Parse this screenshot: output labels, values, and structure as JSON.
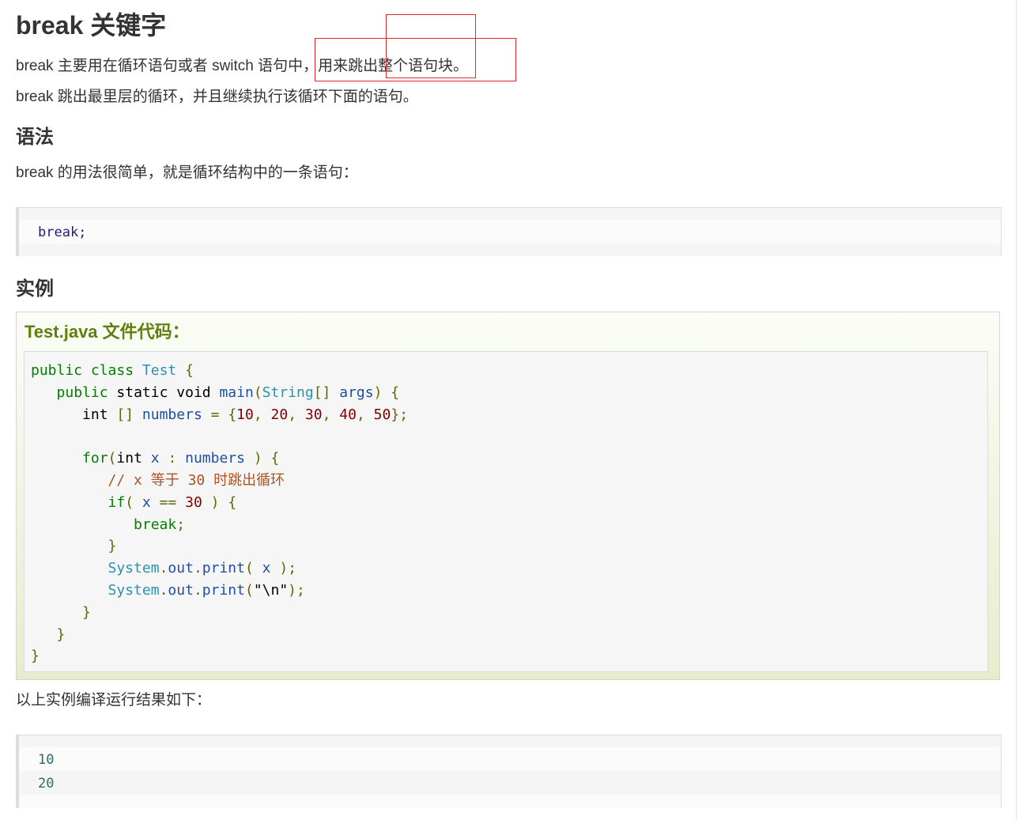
{
  "title": "break 关键字",
  "intro": {
    "line1": "break 主要用在循环语句或者 switch 语句中，用来跳出整个语句块。",
    "line2": "break 跳出最里层的循环，并且继续执行该循环下面的语句。"
  },
  "syntax": {
    "heading": "语法",
    "desc": "break 的用法很简单，就是循环结构中的一条语句：",
    "code": "break;"
  },
  "example": {
    "heading": "实例",
    "file_title": "Test.java 文件代码：",
    "code_lines": [
      "public class Test {",
      "   public static void main(String[] args) {",
      "      int [] numbers = {10, 20, 30, 40, 50};",
      "",
      "      for(int x : numbers ) {",
      "         // x 等于 30 时跳出循环",
      "         if( x == 30 ) {",
      "            break;",
      "         }",
      "         System.out.print( x );",
      "         System.out.print(\"\\n\");",
      "      }",
      "   }",
      "}"
    ]
  },
  "result": {
    "desc": "以上实例编译运行结果如下：",
    "lines": [
      "10",
      "20"
    ]
  },
  "colors": {
    "annotation_box": "#e3262b",
    "example_title": "#617f10",
    "keyword": "#008000"
  }
}
